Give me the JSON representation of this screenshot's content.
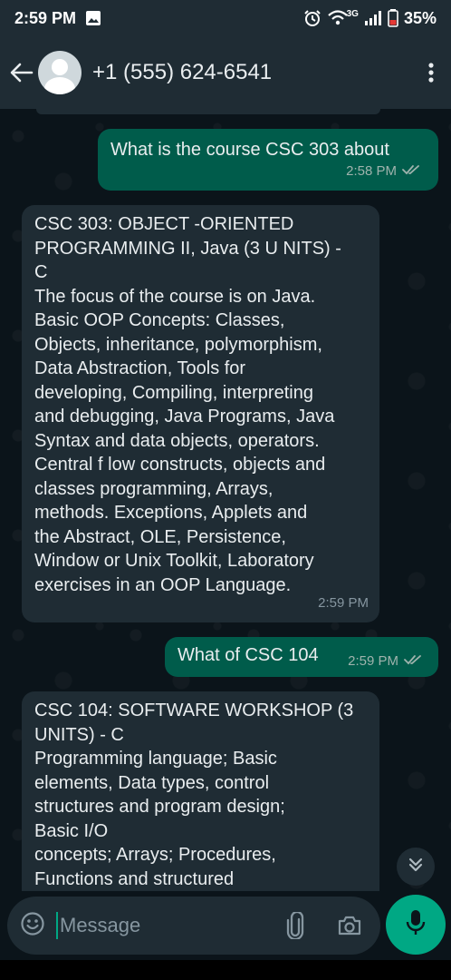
{
  "status_bar": {
    "time": "2:59 PM",
    "network": "3G",
    "battery": "35%",
    "icons": [
      "gallery-icon",
      "alarm-icon",
      "wifi-icon",
      "signal-icon",
      "battery-icon"
    ]
  },
  "header": {
    "contact": "+1 (555) 624-6541",
    "icons": [
      "back-arrow-icon",
      "avatar",
      "more-vert-icon"
    ]
  },
  "messages": [
    {
      "direction": "out",
      "text": "What is the course CSC 303 about",
      "time": "2:58 PM",
      "status": "read"
    },
    {
      "direction": "in",
      "lines": [
        "CSC 303: OBJECT -ORIENTED",
        "PROGRAMMING II, Java (3 U NITS) -",
        "C",
        "The focus of the course is on Java.",
        "Basic OOP Concepts: Classes,",
        "Objects, inheritance, polymorphism,",
        "Data Abstraction, Tools for",
        "developing, Compiling, interpreting",
        "and debugging, Java Programs, Java",
        "Syntax and data objects, operators.",
        "Central f low constructs, objects and",
        "classes programming, Arrays,",
        "methods. Exceptions, Applets and",
        "the Abstract, OLE, Persistence,",
        "Window or Unix Toolkit, Laboratory",
        "exercises in an OOP Language."
      ],
      "time": "2:59 PM"
    },
    {
      "direction": "out",
      "text": "What of CSC 104",
      "time": "2:59 PM",
      "status": "read"
    },
    {
      "direction": "in",
      "lines": [
        "CSC 104: SOFTWARE WORKSHOP (3",
        "UNITS) - C",
        "Programming language; Basic",
        "elements, Data types, control",
        "structures and program design;",
        "Basic I/O",
        "concepts; Arrays; Procedures,",
        "Functions and structured"
      ]
    }
  ],
  "composer": {
    "placeholder": "Message",
    "icons": [
      "emoji-icon",
      "attach-icon",
      "camera-icon",
      "mic-icon"
    ]
  },
  "colors": {
    "outgoing_bubble": "#005c4b",
    "incoming_bubble": "#1f2c34",
    "accent": "#00a884",
    "read_ticks": "#9fb3ad"
  }
}
